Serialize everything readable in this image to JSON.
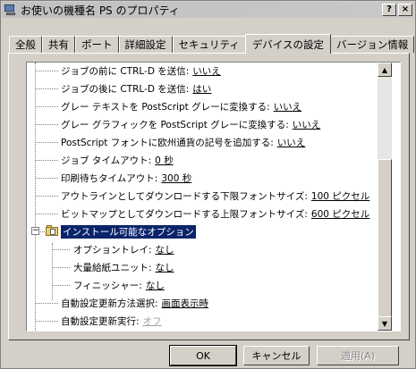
{
  "window": {
    "title": "お使いの機種名 PS のプロパティ",
    "help_button": "?",
    "close_button": "×"
  },
  "tabs": [
    {
      "label": "全般"
    },
    {
      "label": "共有"
    },
    {
      "label": "ポート"
    },
    {
      "label": "詳細設定"
    },
    {
      "label": "セキュリティ"
    },
    {
      "label": "デバイスの設定",
      "active": true
    },
    {
      "label": "バージョン情報"
    }
  ],
  "tree": {
    "items": [
      {
        "label": "ジョブの前に CTRL-D を送信:",
        "value": "いいえ"
      },
      {
        "label": "ジョブの後に CTRL-D を送信:",
        "value": "はい"
      },
      {
        "label": "グレー テキストを PostScript グレーに変換する:",
        "value": "いいえ"
      },
      {
        "label": "グレー グラフィックを PostScript グレーに変換する:",
        "value": "いいえ"
      },
      {
        "label": "PostScript フォントに欧州通貨の記号を追加する:",
        "value": "いいえ"
      },
      {
        "label": "ジョブ タイムアウト:",
        "value": "0 秒"
      },
      {
        "label": "印刷待ちタイムアウト:",
        "value": "300 秒"
      },
      {
        "label": "アウトラインとしてダウンロードする下限フォントサイズ:",
        "value": "100 ピクセル"
      },
      {
        "label": "ビットマップとしてダウンロードする上限フォントサイズ:",
        "value": "600 ピクセル"
      }
    ],
    "group": {
      "expander": "−",
      "label": "インストール可能なオプション",
      "children": [
        {
          "label": "オプショントレイ:",
          "value": "なし"
        },
        {
          "label": "大量給紙ユニット:",
          "value": "なし"
        },
        {
          "label": "フィニッシャー:",
          "value": "なし"
        }
      ]
    },
    "after": [
      {
        "label": "自動設定更新方法選択:",
        "value": "画面表示時"
      },
      {
        "label": "自動設定更新実行:",
        "value": "オフ",
        "disabled": true
      }
    ]
  },
  "scrollbar": {
    "up_arrow": "▲",
    "down_arrow": "▼"
  },
  "buttons": {
    "ok": "OK",
    "cancel": "キャンセル",
    "apply": "適用(A)"
  }
}
